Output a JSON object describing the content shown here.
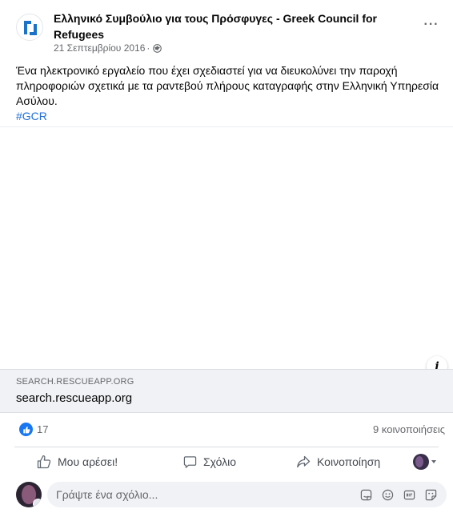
{
  "post": {
    "page_name": "Ελληνικό Συμβούλιο για τους Πρόσφυγες - Greek Council for Refugees",
    "date": "21 Σεπτεμβρίου 2016",
    "meta_separator": "·",
    "more_label": "···",
    "text": "Ένα ηλεκτρονικό εργαλείο που έχει σχεδιαστεί για να διευκολύνει την παροχή πληροφοριών σχετικά με τα ραντεβού πλήρους καταγραφής στην Ελληνική Υπηρεσία Ασύλου.",
    "hashtag": "#GCR",
    "brand_color": "#1a73c9"
  },
  "link_preview": {
    "info_label": "i",
    "domain": "SEARCH.RESCUEAPP.ORG",
    "title": "search.rescueapp.org"
  },
  "reactions": {
    "like_count": "17",
    "shares": "9 κοινοποιήσεις",
    "like_color": "#1877f2"
  },
  "actions": {
    "like_label": "Μου αρέσει!",
    "comment_label": "Σχόλιο",
    "share_label": "Κοινοποίηση"
  },
  "comment_box": {
    "placeholder": "Γράψτε ένα σχόλιο..."
  },
  "icons": {
    "page_logo": "gcr-logo",
    "audience": "globe-icon",
    "info": "info-icon",
    "like_reaction": "thumbs-up-icon",
    "like_action": "thumbs-up-outline-icon",
    "comment_action": "speech-bubble-icon",
    "share_action": "share-arrow-icon",
    "tools": [
      "sticker-icon",
      "emoji-icon",
      "gif-icon",
      "sticker-face-icon"
    ]
  }
}
